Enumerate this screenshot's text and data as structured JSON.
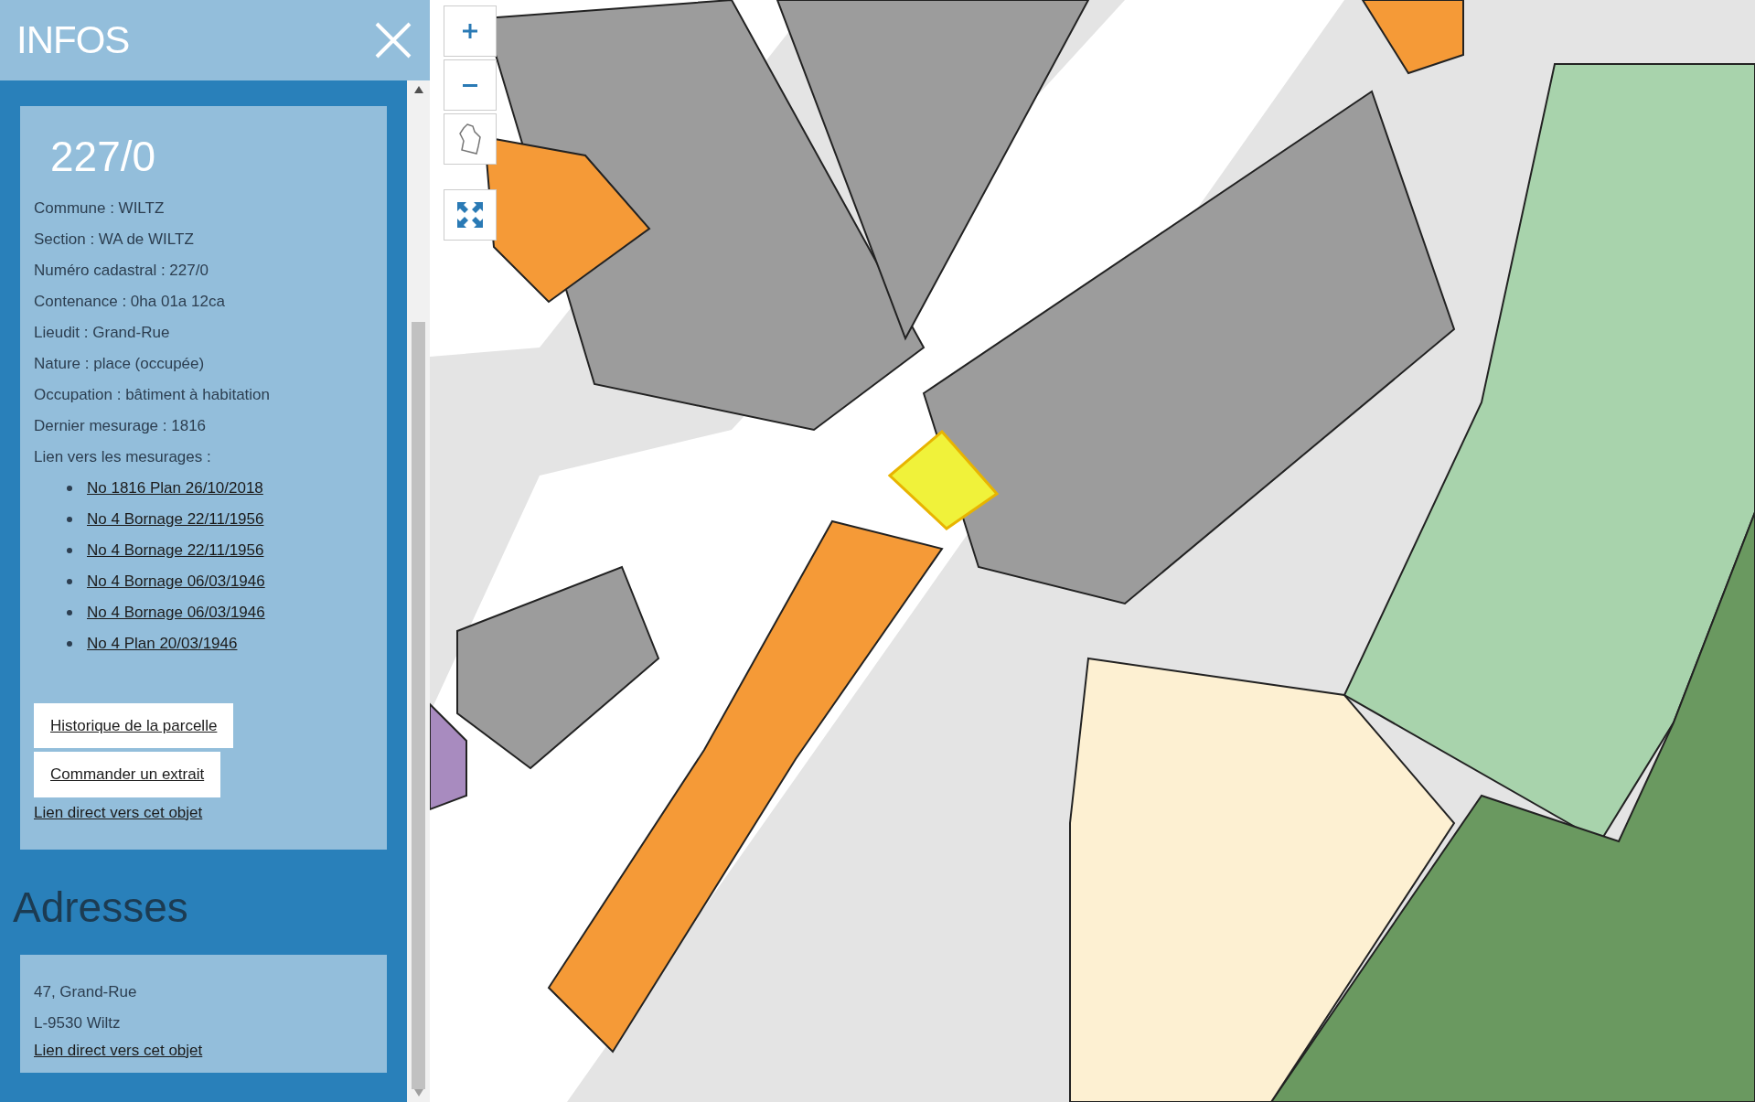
{
  "panel": {
    "title": "INFOS"
  },
  "parcel": {
    "number": "227/0",
    "fields": [
      "Commune : WILTZ",
      "Section : WA de WILTZ",
      "Numéro cadastral : 227/0",
      "Contenance : 0ha 01a 12ca",
      "Lieudit : Grand-Rue",
      "Nature : place (occupée)",
      "Occupation : bâtiment à habitation",
      "Dernier mesurage : 1816"
    ],
    "links_label": "Lien vers les mesurages :",
    "links": [
      "No 1816 Plan 26/10/2018",
      "No 4 Bornage 22/11/1956",
      "No 4 Bornage 22/11/1956",
      "No 4 Bornage 06/03/1946",
      "No 4 Bornage 06/03/1946",
      "No 4 Plan 20/03/1946"
    ],
    "buttons": [
      "Historique de la parcelle",
      "Commander un extrait"
    ],
    "direct_link": "Lien direct vers cet objet"
  },
  "addresses": {
    "heading": "Adresses",
    "lines": [
      "47, Grand-Rue",
      "L-9530 Wiltz"
    ],
    "direct_link": "Lien direct vers cet objet"
  }
}
